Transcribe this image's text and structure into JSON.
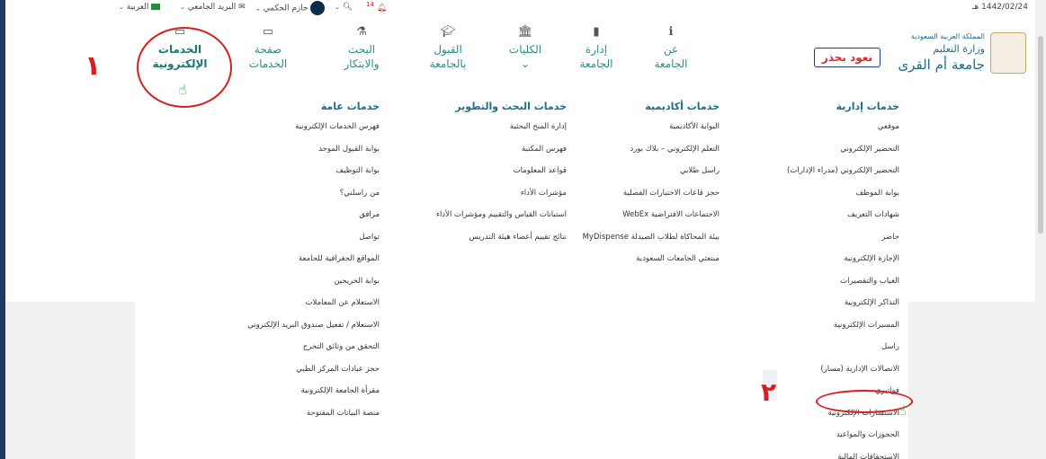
{
  "topbar": {
    "date": "1442/02/24 هـ",
    "notif_count": "14",
    "user_name": "حازم الحكمي",
    "mail_label": "البريد الجامعي",
    "lang_label": "العربية"
  },
  "brand": {
    "line1": "المملكة العربية السعودية",
    "line2": "وزارة التعليم",
    "line3": "جامعة أم القرى",
    "campaign": "نعود بحذر"
  },
  "nav": [
    {
      "label": "عن\nالجامعة",
      "icon": "info-icon"
    },
    {
      "label": "إدارة\nالجامعة",
      "icon": "building-icon"
    },
    {
      "label": "الكليات\n⌄",
      "icon": "institution-icon"
    },
    {
      "label": "القبول\nبالجامعة",
      "icon": "graduation-cap-icon"
    },
    {
      "label": "البحث\nوالابتكار",
      "icon": "flask-icon"
    },
    {
      "label": "صفحة\nالخدمات",
      "icon": "laptop-icon"
    },
    {
      "label": "الخدمات\nالإلكترونية",
      "icon": "laptop-icon"
    }
  ],
  "columns": [
    {
      "title": "خدمات إدارية",
      "items": [
        "موقعي",
        "التحضير الإلكتروني",
        "التحضير الإلكتروني (مدراء الإدارات)",
        "بوابة الموظف",
        "شهادات التعريف",
        "حاضر",
        "الإجازة الإلكترونية",
        "الغياب والتقصيرات",
        "التذاكر الإلكترونية",
        "المسيرات الإلكترونية",
        "راسل",
        "الاتصالات الإدارية (مسار)",
        "فواتيري",
        "الاستشارات الإلكترونية",
        "الحجوزات والمواعيد",
        "الاستحقاقات المالية"
      ]
    },
    {
      "title": "خدمات أكاديمية",
      "items": [
        "البوابة الأكاديمية",
        "التعلم الإلكتروني – بلاك بورد",
        "راسل طلابي",
        "حجز قاعات الاختبارات الفصلية",
        "الاجتماعات الافتراضية WebEx",
        "بيئة المحاكاة لطلاب الصيدلة MyDispense",
        "مبتعثي الجامعات السعودية"
      ]
    },
    {
      "title": "خدمات البحث والتطوير",
      "items": [
        "إدارة المنح البحثية",
        "فهرس المكتبة",
        "قواعد المعلومات",
        "مؤشرات الأداء",
        "استبانات القياس والتقييم ومؤشرات الأداء",
        "نتائج تقييم أعضاء هيئة التدريس"
      ]
    },
    {
      "title": "خدمات عامة",
      "items": [
        "فهرس الخدمات الإلكترونية",
        "بوابة القبول الموحد",
        "بوابة التوظيف",
        "من راسلني؟",
        "مرافق",
        "تواصل",
        "المواقع الجغرافية للجامعة",
        "بوابة الخريجين",
        "الاستعلام عن المعاملات",
        "الاستعلام / تفعيل صندوق البريد الإلكتروني",
        "التحقق من وثائق التخرج",
        "حجز عيادات المركز الطبي",
        "مقرأة الجامعة الإلكترونية",
        "منصة البيانات المفتوحة"
      ]
    }
  ],
  "annotations": {
    "one": "١",
    "two": "٢"
  },
  "colors": {
    "accent": "#2e8b8b",
    "heading": "#1b6f8b",
    "annotation": "#d91e1e",
    "frame": "#1d3a63"
  }
}
